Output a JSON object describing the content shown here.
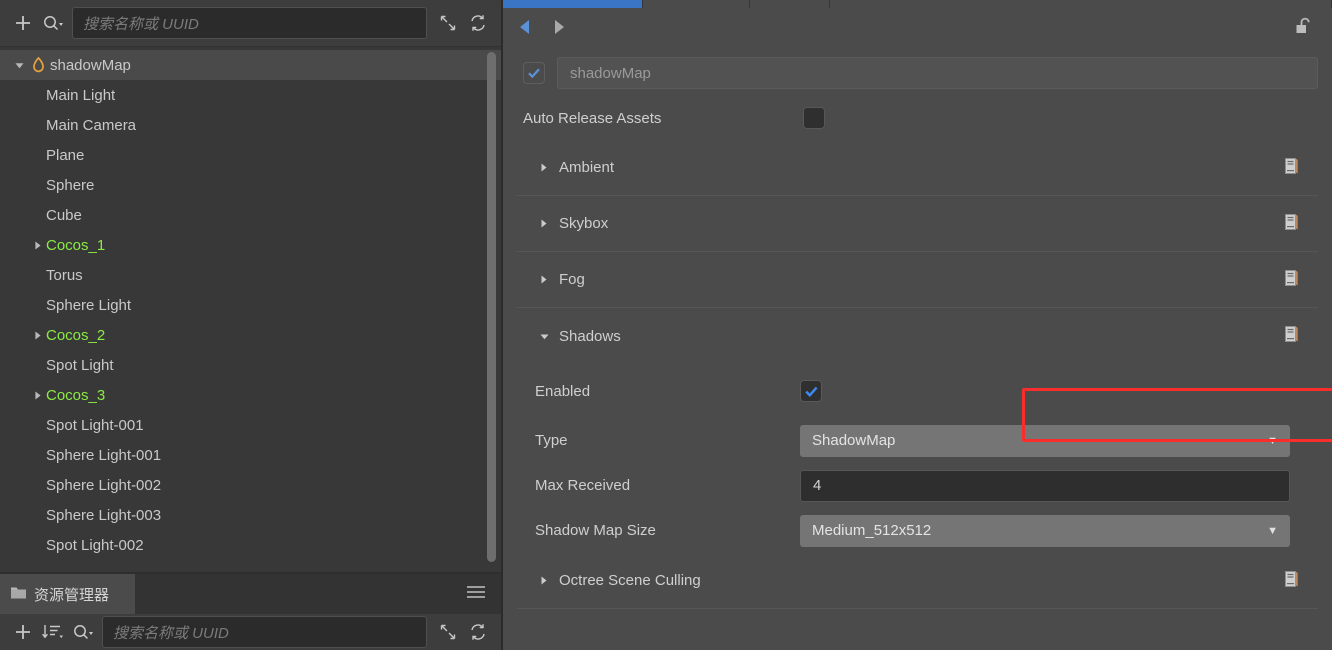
{
  "hierarchy": {
    "toolbar": {
      "add_label": "+",
      "search_placeholder": "搜索名称或 UUID",
      "collapse_icon": "collapse-arrows-icon",
      "refresh_icon": "refresh-icon",
      "search_icon": "search-icon"
    },
    "nodes": [
      {
        "label": "shadowMap",
        "depth": 0,
        "arrow": "down",
        "icon": "flame-icon",
        "selected": true,
        "color": "default"
      },
      {
        "label": "Main Light",
        "depth": 1,
        "arrow": "none",
        "icon": "",
        "selected": false,
        "color": "default"
      },
      {
        "label": "Main Camera",
        "depth": 1,
        "arrow": "none",
        "icon": "",
        "selected": false,
        "color": "default"
      },
      {
        "label": "Plane",
        "depth": 1,
        "arrow": "none",
        "icon": "",
        "selected": false,
        "color": "default"
      },
      {
        "label": "Sphere",
        "depth": 1,
        "arrow": "none",
        "icon": "",
        "selected": false,
        "color": "default"
      },
      {
        "label": "Cube",
        "depth": 1,
        "arrow": "none",
        "icon": "",
        "selected": false,
        "color": "default"
      },
      {
        "label": "Cocos_1",
        "depth": 1,
        "arrow": "right",
        "icon": "",
        "selected": false,
        "color": "green"
      },
      {
        "label": "Torus",
        "depth": 1,
        "arrow": "none",
        "icon": "",
        "selected": false,
        "color": "default"
      },
      {
        "label": "Sphere Light",
        "depth": 1,
        "arrow": "none",
        "icon": "",
        "selected": false,
        "color": "default"
      },
      {
        "label": "Cocos_2",
        "depth": 1,
        "arrow": "right",
        "icon": "",
        "selected": false,
        "color": "green"
      },
      {
        "label": "Spot Light",
        "depth": 1,
        "arrow": "none",
        "icon": "",
        "selected": false,
        "color": "default"
      },
      {
        "label": "Cocos_3",
        "depth": 1,
        "arrow": "right",
        "icon": "",
        "selected": false,
        "color": "green"
      },
      {
        "label": "Spot Light-001",
        "depth": 1,
        "arrow": "none",
        "icon": "",
        "selected": false,
        "color": "default"
      },
      {
        "label": "Sphere Light-001",
        "depth": 1,
        "arrow": "none",
        "icon": "",
        "selected": false,
        "color": "default"
      },
      {
        "label": "Sphere Light-002",
        "depth": 1,
        "arrow": "none",
        "icon": "",
        "selected": false,
        "color": "default"
      },
      {
        "label": "Sphere Light-003",
        "depth": 1,
        "arrow": "none",
        "icon": "",
        "selected": false,
        "color": "default"
      },
      {
        "label": "Spot Light-002",
        "depth": 1,
        "arrow": "none",
        "icon": "",
        "selected": false,
        "color": "default"
      }
    ]
  },
  "assets": {
    "tab_label": "资源管理器",
    "tab_icon": "folder-icon",
    "menu_icon": "hamburger-icon",
    "toolbar": {
      "add_label": "+",
      "sort_icon": "sort-descending-icon",
      "search_icon": "search-icon",
      "search_placeholder": "搜索名称或 UUID",
      "collapse_icon": "collapse-arrows-icon",
      "refresh_icon": "refresh-icon"
    }
  },
  "inspector": {
    "tabs": [
      {
        "active": true
      },
      {
        "active": false
      },
      {
        "active": false
      },
      {
        "active": false
      }
    ],
    "nav": {
      "back_icon": "arrow-left-icon",
      "forward_icon": "arrow-right-icon"
    },
    "lock_icon": "unlock-icon",
    "node": {
      "enabled": true,
      "name": "shadowMap"
    },
    "auto_release": {
      "label": "Auto Release Assets",
      "checked": false
    },
    "sections": [
      {
        "title": "Ambient",
        "expanded": false,
        "icon": "book-icon"
      },
      {
        "title": "Skybox",
        "expanded": false,
        "icon": "book-icon"
      },
      {
        "title": "Fog",
        "expanded": false,
        "icon": "book-icon"
      },
      {
        "title": "Shadows",
        "expanded": true,
        "icon": "book-icon"
      },
      {
        "title": "Octree Scene Culling",
        "expanded": false,
        "icon": "book-icon"
      }
    ],
    "shadows": {
      "enabled": {
        "label": "Enabled",
        "checked": true
      },
      "type": {
        "label": "Type",
        "value": "ShadowMap"
      },
      "max_received": {
        "label": "Max Received",
        "value": "4"
      },
      "shadow_map_size": {
        "label": "Shadow Map Size",
        "value": "Medium_512x512"
      }
    }
  },
  "colors": {
    "accent_blue": "#3a74c4",
    "highlight_red": "#fa2d2d",
    "green_label": "#8aeb45",
    "flame_orange": "#e8a33d"
  }
}
